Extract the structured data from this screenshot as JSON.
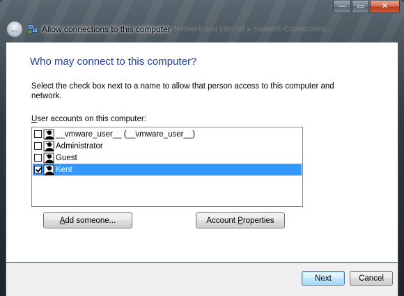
{
  "window": {
    "title": "Allow connections to this computer",
    "faint_address": "Network and Internet  ▸  Network Connections",
    "minimize_glyph": "—",
    "maximize_glyph": "▭",
    "close_glyph": "✕",
    "back_glyph": "←"
  },
  "main": {
    "heading": "Who may connect to this computer?",
    "description": "Select the check box next to a name to allow that person access to this computer and network.",
    "list_label_mnemonic": "U",
    "list_label_rest": "ser accounts on this computer:",
    "users": [
      {
        "label": "__vmware_user__ (__vmware_user__)",
        "checked": false,
        "selected": false
      },
      {
        "label": "Administrator",
        "checked": false,
        "selected": false
      },
      {
        "label": "Guest",
        "checked": false,
        "selected": false
      },
      {
        "label": "Kent",
        "checked": true,
        "selected": true
      }
    ],
    "add_button_mnemonic": "A",
    "add_button_rest": "dd someone...",
    "props_button_pre": "Account ",
    "props_button_mnemonic": "P",
    "props_button_rest": "roperties"
  },
  "footer": {
    "next_label": "Next",
    "cancel_label": "Cancel"
  },
  "colors": {
    "heading": "#1e3f96",
    "selection": "#3399ff"
  }
}
